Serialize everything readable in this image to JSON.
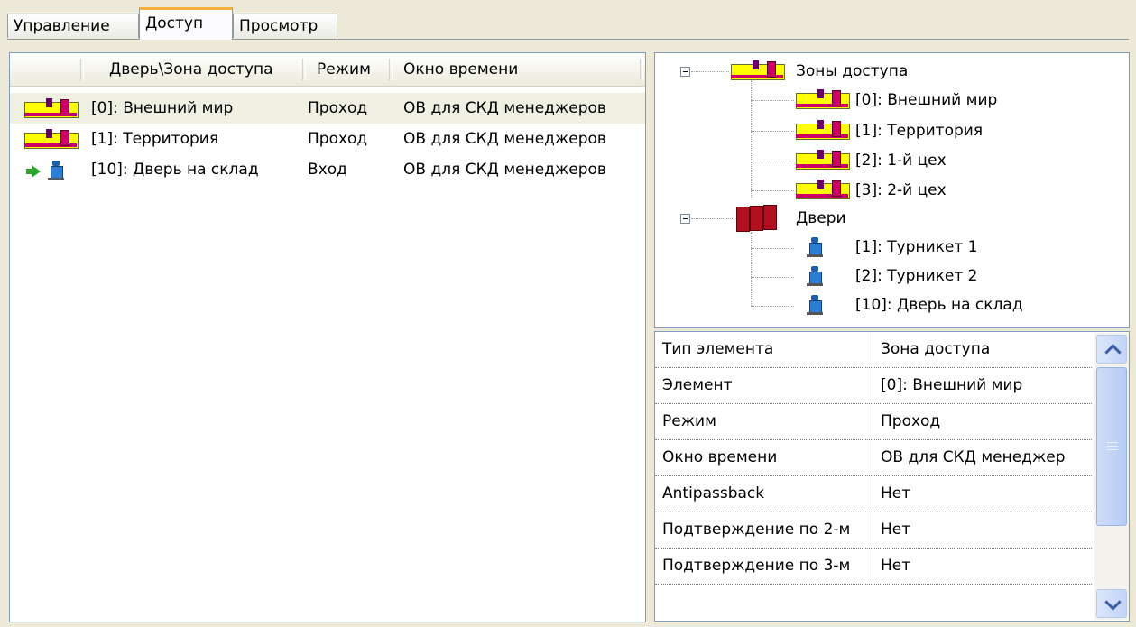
{
  "tabs": [
    {
      "label": "Управление",
      "active": false
    },
    {
      "label": "Доступ",
      "active": true
    },
    {
      "label": "Просмотр",
      "active": false
    }
  ],
  "access_list": {
    "columns": [
      "Дверь\\Зона доступа",
      "Режим",
      "Окно времени"
    ],
    "rows": [
      {
        "icon": "access-zone-icon",
        "name": "[0]: Внешний мир",
        "mode": "Проход",
        "time_window": "ОВ для СКД менеджеров",
        "selected": true
      },
      {
        "icon": "access-zone-icon",
        "name": "[1]: Территория",
        "mode": "Проход",
        "time_window": "ОВ для СКД менеджеров",
        "selected": false
      },
      {
        "icon": "entry-turnstile-icon",
        "name": "[10]: Дверь на склад",
        "mode": "Вход",
        "time_window": "ОВ для СКД менеджеров",
        "selected": false
      }
    ]
  },
  "tree": {
    "zones_group": {
      "label": "Зоны доступа",
      "items": [
        "[0]: Внешний мир",
        "[1]: Территория",
        "[2]: 1-й цех",
        "[3]: 2-й цех"
      ]
    },
    "doors_group": {
      "label": "Двери",
      "items": [
        "[1]: Турникет 1",
        "[2]: Турникет 2",
        "[10]: Дверь на склад"
      ]
    }
  },
  "properties": [
    {
      "name": "Тип элемента",
      "value": "Зона доступа"
    },
    {
      "name": "Элемент",
      "value": "[0]: Внешний мир"
    },
    {
      "name": "Режим",
      "value": "Проход"
    },
    {
      "name": "Окно времени",
      "value": "ОВ для СКД менеджер"
    },
    {
      "name": "Antipassback",
      "value": "Нет"
    },
    {
      "name": "Подтверждение по 2-м",
      "value": "Нет"
    },
    {
      "name": "Подтверждение по 3-м",
      "value": "Нет"
    }
  ],
  "colors": {
    "window_bg": "#ece9d8",
    "zone_yellow": "#ffff00",
    "zone_accent": "#cc0066",
    "door_red": "#b01020",
    "turnstile_blue": "#2b7ed4",
    "tab_active_accent": "#f8b03c",
    "selection_bg": "#efefe2"
  }
}
